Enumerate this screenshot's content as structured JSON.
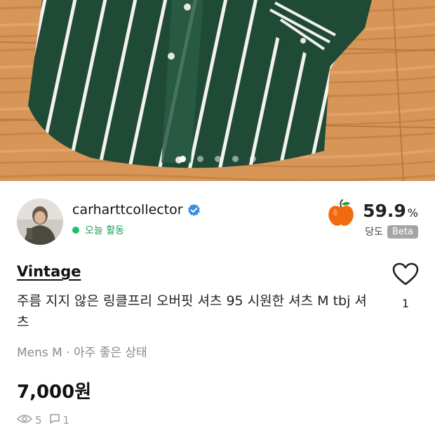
{
  "gallery": {
    "image_count": 5,
    "active_index": 0
  },
  "seller": {
    "username": "carharttcollector",
    "verified": true,
    "activity": "오늘 활동",
    "temperature_value": "59.9",
    "temperature_unit": "%",
    "temperature_label": "당도",
    "beta_badge": "Beta"
  },
  "listing": {
    "brand": "Vintage",
    "title": "주름 지지 않은 링클프리 오버핏 셔츠 95 시원한 셔츠 M tbj 셔츠",
    "condition": "Mens M · 아주 좋은 상태",
    "price": "7,000원",
    "likes": "1",
    "views": "5",
    "comments": "1"
  },
  "colors": {
    "shirt_green": "#1f4a36",
    "floor_wood": "#d8955a",
    "activity_green": "#1fbf63",
    "verified_blue": "#3a8fe0",
    "apple_orange": "#f26a10",
    "beta_gray": "#a5a5a5"
  },
  "icons": [
    "verified-badge-icon",
    "orange-apple-icon",
    "heart-icon",
    "eye-icon",
    "comment-icon"
  ]
}
